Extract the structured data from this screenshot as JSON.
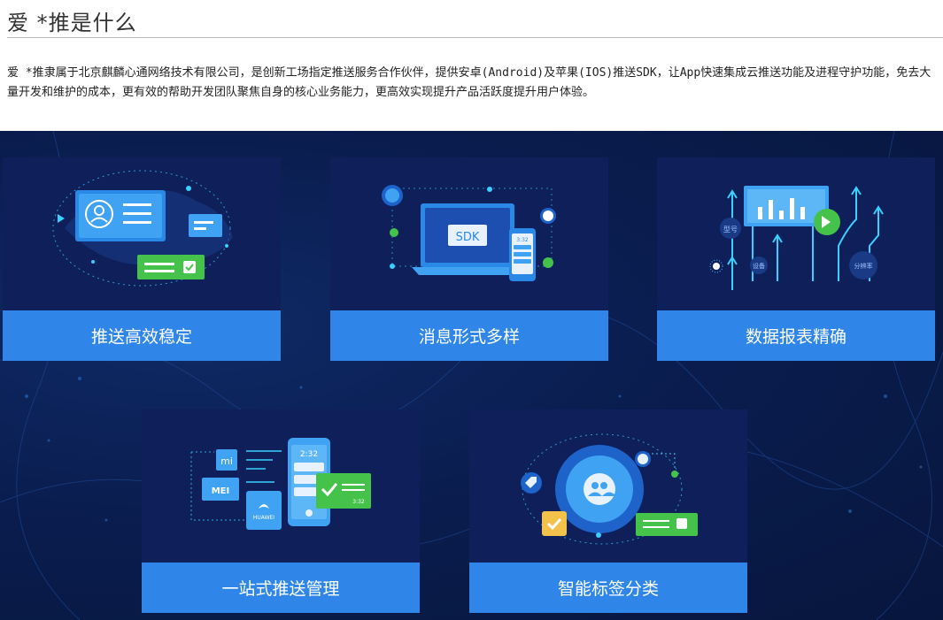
{
  "page": {
    "title": "爱 *推是什么",
    "intro": "爱 *推隶属于北京麒麟心通网络技术有限公司，是创新工场指定推送服务合作伙伴，提供安卓(Android)及苹果(IOS)推送SDK，让App快速集成云推送功能及进程守护功能，免去大量开发和维护的成本，更有效的帮助开发团队聚焦自身的核心业务能力，更高效实现提升产品活跃度提升用户体验。"
  },
  "features": [
    {
      "label": "推送高效稳定",
      "icon": "id-card-network-icon"
    },
    {
      "label": "消息形式多样",
      "icon": "sdk-laptop-icon",
      "art_text": {
        "sdk": "SDK",
        "time": "3:32"
      }
    },
    {
      "label": "数据报表精确",
      "icon": "report-chart-icon",
      "art_text": {
        "tag1": "型号",
        "tag2": "设备",
        "tag3": "分辨率"
      }
    },
    {
      "label": "一站式推送管理",
      "icon": "phone-brands-icon",
      "art_text": {
        "mi": "mi",
        "meizu": "MEI",
        "huawei": "HUAWEI",
        "time": "2:32",
        "msg_time": "3:32"
      }
    },
    {
      "label": "智能标签分类",
      "icon": "user-tag-icon"
    }
  ],
  "colors": {
    "caption": "#2f86e8",
    "card": "#0e1f5a",
    "banner": "#0a1d4f",
    "accent_cyan": "#3ad0ff",
    "accent_green": "#45c24a"
  }
}
